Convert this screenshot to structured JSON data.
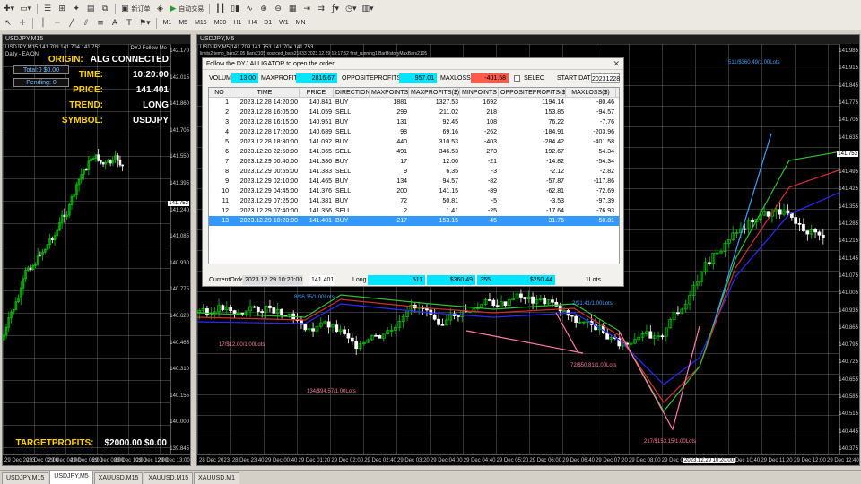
{
  "toolbar": {
    "new_order": "新订单",
    "auto_trade": "自动交易",
    "timeframes": [
      "M1",
      "M5",
      "M15",
      "M30",
      "H1",
      "H4",
      "D1",
      "W1",
      "MN"
    ]
  },
  "left_chart": {
    "title": "USDJPY,M15",
    "info_line": "USDJPY,M15  141.709 141.704 141.753",
    "ea_status": "Daily - EA ON",
    "corner": "DYJ Follow Me",
    "box_total": "Total:0 $0.00",
    "box_pending": "Pending: 0",
    "rows": [
      {
        "label": "ORIGIN:",
        "value": "ALG CONNECTED"
      },
      {
        "label": "TIME:",
        "value": "10:20:00"
      },
      {
        "label": "PRICE:",
        "value": "141.401"
      },
      {
        "label": "TREND:",
        "value": "LONG"
      },
      {
        "label": "SYMBOL:",
        "value": "USDJPY"
      }
    ],
    "target_label": "TARGETPROFITS:",
    "target_value": "$2000.00 $0.00",
    "prices": [
      "142.170",
      "142.015",
      "141.860",
      "141.705",
      "141.550",
      "141.395",
      "141.240",
      "141.085",
      "140.930",
      "140.775",
      "140.620",
      "140.465",
      "140.310",
      "140.155",
      "140.000",
      "139.845"
    ],
    "current_price": "141.753",
    "times": [
      "29 Dec 2023",
      "29 Dec 02:00",
      "29 Dec 04:00",
      "29 Dec 06:00",
      "29 Dec 08:00",
      "29 Dec 10:00",
      "29 Dec 12:00",
      "29 Dec 13:00"
    ]
  },
  "right_chart": {
    "title": "USDJPY,M5",
    "info_line": "USDJPY,M5  141.709 141.753 141.704 141.753",
    "sub_line": "limits2 temp_bars2105 Bars2105 sourced_bars21833 2023.12.29 13:17:52 first_running1 BarHistoryMaxBars2105",
    "prices": [
      "141.985",
      "141.915",
      "141.845",
      "141.775",
      "141.705",
      "141.635",
      "141.565",
      "141.495",
      "141.425",
      "141.355",
      "141.285",
      "141.215",
      "141.145",
      "141.075",
      "141.005",
      "140.935",
      "140.865",
      "140.795",
      "140.725",
      "140.655",
      "140.585",
      "140.515",
      "140.445",
      "140.375"
    ],
    "current_price": "141.753",
    "time_marker": "2023.12.29 10:20:00",
    "times": [
      "28 Dec 2023",
      "28 Dec 23:40",
      "29 Dec 00:40",
      "29 Dec 01:20",
      "29 Dec 02:00",
      "29 Dec 02:40",
      "29 Dec 03:20",
      "29 Dec 04:00",
      "29 Dec 04:40",
      "29 Dec 05:20",
      "29 Dec 06:00",
      "29 Dec 06:40",
      "29 Dec 07:20",
      "29 Dec 08:00",
      "29 Dec 08:40",
      "29 Dec 09:20",
      "29 Dec 10:40",
      "29 Dec 11:20",
      "29 Dec 12:00",
      "29 Dec 12:40"
    ],
    "annotations": [
      {
        "text": "511/$360.49/1.00Lots",
        "color": "#3aa0ff"
      },
      {
        "text": "8/$6.35/1.00Lots",
        "color": "#3aa0ff"
      },
      {
        "text": "17/$12.00/1.00Lots",
        "color": "#ff7a9a"
      },
      {
        "text": "134/$94.57/1.00Lots",
        "color": "#ff7a9a"
      },
      {
        "text": "2/$1.41/1.00Lots",
        "color": "#3aa0ff"
      },
      {
        "text": "72/$50.81/1.00Lots",
        "color": "#ff7a9a"
      },
      {
        "text": "217/$153.15/1.00Lots",
        "color": "#ff7a9a"
      }
    ]
  },
  "dialog": {
    "title": "Follow the DYJ ALLIGATOR to open the order.",
    "volume_label": "VOLUME",
    "volume": "13.00",
    "maxprofits_label": "MAXPROFITS",
    "maxprofits": "2816.67",
    "opp_label": "OPPOSITEPROFITS($)",
    "opp": "957.01",
    "maxloss_label": "MAXLOSS($)",
    "maxloss": "-401.58",
    "selec_label": "SELEC",
    "start_label": "START DATE",
    "start": "20231228",
    "headers": [
      "NO",
      "TIME",
      "PRICE",
      "DIRECTION",
      "MAXPOINTS",
      "MAXPROFITS($)",
      "MINPOINTS",
      "OPPOSITEPROFITS($)",
      "MAXLOSS($)"
    ],
    "rows": [
      [
        "1",
        "2023.12.28 14:20:00",
        "140.841",
        "BUY",
        "1881",
        "1327.53",
        "1692",
        "1194.14",
        "-80.46"
      ],
      [
        "2",
        "2023.12.28 16:05:00",
        "141.059",
        "SELL",
        "299",
        "211.02",
        "218",
        "153.85",
        "-94.57"
      ],
      [
        "3",
        "2023.12.28 16:15:00",
        "140.951",
        "BUY",
        "131",
        "92.45",
        "108",
        "76.22",
        "-7.76"
      ],
      [
        "4",
        "2023.12.28 17:20:00",
        "140.689",
        "SELL",
        "98",
        "69.16",
        "-262",
        "-184.91",
        "-203.96"
      ],
      [
        "5",
        "2023.12.28 18:30:00",
        "141.092",
        "BUY",
        "440",
        "310.53",
        "-403",
        "-284.42",
        "-401.58"
      ],
      [
        "6",
        "2023.12.28 22:50:00",
        "141.365",
        "SELL",
        "491",
        "346.53",
        "273",
        "192.67",
        "-54.34"
      ],
      [
        "7",
        "2023.12.29 00:40:00",
        "141.386",
        "BUY",
        "17",
        "12.00",
        "-21",
        "-14.82",
        "-54.34"
      ],
      [
        "8",
        "2023.12.29 00:55:00",
        "141.383",
        "SELL",
        "9",
        "6.35",
        "-3",
        "-2.12",
        "-2.82"
      ],
      [
        "9",
        "2023.12.29 02:10:00",
        "141.465",
        "BUY",
        "134",
        "94.57",
        "-82",
        "-57.87",
        "-117.86"
      ],
      [
        "10",
        "2023.12.29 04:45:00",
        "141.376",
        "SELL",
        "200",
        "141.15",
        "-89",
        "-62.81",
        "-72.69"
      ],
      [
        "11",
        "2023.12.29 07:25:00",
        "141.381",
        "BUY",
        "72",
        "50.81",
        "-5",
        "-3.53",
        "-97.39"
      ],
      [
        "12",
        "2023.12.29 07:40:00",
        "141.356",
        "SELL",
        "2",
        "1.41",
        "-25",
        "-17.64",
        "-76.93"
      ],
      [
        "13",
        "2023.12.29 10:20:00",
        "141.401",
        "BUY",
        "217",
        "153.15",
        "-45",
        "-31.76",
        "-50.81"
      ]
    ],
    "current_label": "CurrentOrde",
    "current_time": "2023.12.29 10:20:00",
    "current_price": "141.401",
    "current_dir": "Long",
    "current_maxpoints": "511",
    "current_maxprofits": "$360.49",
    "current_minpoints": "355",
    "current_opp": "$250.44",
    "current_lots": "1Lots"
  },
  "tabs": [
    "USDJPY,M15",
    "USDJPY,M5",
    "XAUUSD,M15",
    "XAUUSD,M15",
    "XAUUSD,M1"
  ],
  "colors": {
    "bull": "#00cc00",
    "bear": "#ffffff",
    "accent": "#00e5ff",
    "loss": "#ff5a4a",
    "select": "#3399ff"
  }
}
